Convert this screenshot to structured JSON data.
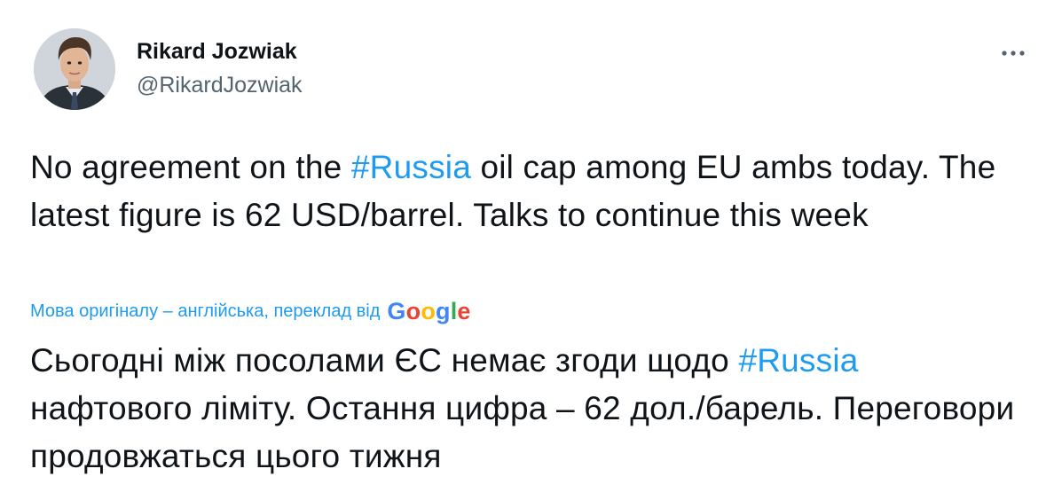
{
  "author": {
    "name": "Rikard Jozwiak",
    "handle": "@RikardJozwiak",
    "avatar_icon": "profile-photo-avatar"
  },
  "menu_icon": "more-options-icon",
  "tweet": {
    "original": {
      "before": "No agreement on the ",
      "hashtag": "#Russia",
      "after": " oil cap among EU ambs today. The latest figure is 62 USD/barrel. Talks to continue this week"
    },
    "translation_notice": {
      "label": "Мова оригіналу – англійська, переклад від",
      "provider": "Google",
      "provider_letters": [
        "G",
        "o",
        "o",
        "g",
        "l",
        "e"
      ]
    },
    "translation": {
      "before": "Сьогодні між посолами ЄС немає згоди щодо ",
      "hashtag": "#Russia",
      "after": " нафтового ліміту. Остання цифра – 62 дол./барель. Переговори продовжаться цього тижня"
    }
  },
  "colors": {
    "link": "#1d9bf0",
    "text": "#0f1419",
    "secondary": "#536471",
    "google_blue": "#4285f4",
    "google_red": "#ea4335",
    "google_yellow": "#fbbc05",
    "google_green": "#34a853"
  }
}
